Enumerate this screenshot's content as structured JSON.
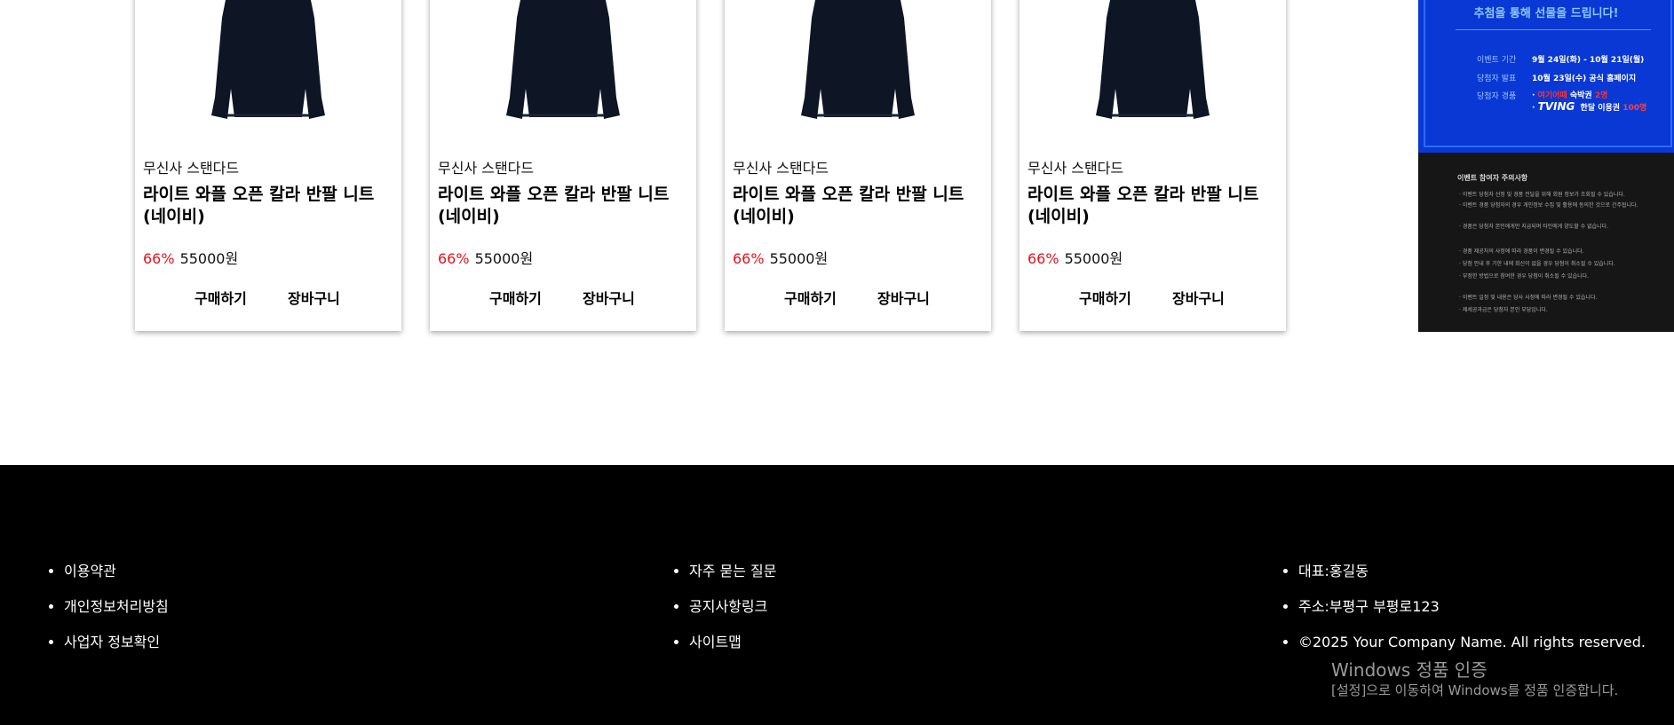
{
  "products": [
    {
      "brand": "무신사 스탠다드",
      "name": "라이트 와플 오픈 칼라 반팔 니트 (네이비)",
      "discount": "66%",
      "price": "55000원",
      "buy_label": "구매하기",
      "cart_label": "장바구니"
    },
    {
      "brand": "무신사 스탠다드",
      "name": "라이트 와플 오픈 칼라 반팔 니트 (네이비)",
      "discount": "66%",
      "price": "55000원",
      "buy_label": "구매하기",
      "cart_label": "장바구니"
    },
    {
      "brand": "무신사 스탠다드",
      "name": "라이트 와플 오픈 칼라 반팔 니트 (네이비)",
      "discount": "66%",
      "price": "55000원",
      "buy_label": "구매하기",
      "cart_label": "장바구니"
    },
    {
      "brand": "무신사 스탠다드",
      "name": "라이트 와플 오픈 칼라 반팔 니트 (네이비)",
      "discount": "66%",
      "price": "55000원",
      "buy_label": "구매하기",
      "cart_label": "장바구니"
    }
  ],
  "banner": {
    "headline": "추첨을 통해 선물을 드립니다!",
    "rows": [
      {
        "key": "이벤트 기간",
        "value": "9월 24일(화) - 10월 21일(월)"
      },
      {
        "key": "당첨자 발표",
        "value": "10월 23일(수) 공식 홈페이지"
      },
      {
        "key": "당첨자 경품",
        "value": ""
      }
    ],
    "prize1": {
      "brand": "여기어때",
      "text": "숙박권",
      "count": "2명"
    },
    "prize2": {
      "brand": "TVING",
      "text": "한달 이용권",
      "count": "100명"
    },
    "notice_title": "이벤트 참여자 주의사항",
    "notice_lines": [
      "· 이벤트 당첨자 선정 및 경품 전달을 위해 회원 정보가 조회될 수 있습니다.",
      "· 이벤트 경품 당첨자의 경우 개인정보 수집 및 활용에 동의한 것으로 간주됩니다.",
      "· 경품은 당첨자 본인에게만 지급되며 타인에게 양도할 수 없습니다.",
      "· 경품 제공처의 사정에 따라 경품이 변경될 수 있습니다.",
      "· 당첨 안내 후 기한 내에 회신이 없을 경우 당첨이 취소될 수 있습니다.",
      "· 부정한 방법으로 참여한 경우 당첨이 취소될 수 있습니다.",
      "· 이벤트 일정 및 내용은 당사 사정에 따라 변경될 수 있습니다.",
      "· 제세공과금은 당첨자 본인 부담입니다."
    ]
  },
  "footer": {
    "col1": [
      "이용약관",
      "개인정보처리방침",
      "사업자 정보확인"
    ],
    "col2": [
      "자주 묻는 질문",
      "공지사항링크",
      "사이트맵"
    ],
    "col3": [
      "대표:홍길동",
      "주소:부평구 부평로123",
      "©2025 Your Company Name. All rights reserved."
    ]
  },
  "watermark": {
    "title": "Windows 정품 인증",
    "subtitle": "[설정]으로 이동하여 Windows를 정품 인증합니다."
  }
}
